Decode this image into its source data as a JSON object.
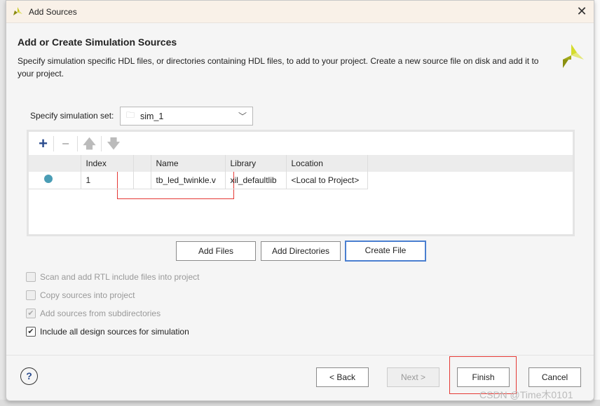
{
  "window": {
    "title": "Add Sources",
    "close_icon": "close-icon"
  },
  "header": {
    "title": "Add or Create Simulation Sources",
    "description": "Specify simulation specific HDL files, or directories containing HDL files, to add to your project. Create a new source file on disk and add it to your project."
  },
  "simset": {
    "label": "Specify simulation set:",
    "value": "sim_1"
  },
  "table": {
    "columns": [
      "",
      "Index",
      "",
      "Name",
      "Library",
      "Location"
    ],
    "rows": [
      {
        "status": "dot",
        "index": "1",
        "name": "tb_led_twinkle.v",
        "library": "xil_defaultlib",
        "location": "<Local to Project>"
      }
    ]
  },
  "buttons": {
    "add_files": "Add Files",
    "add_directories": "Add Directories",
    "create_file": "Create File",
    "back": "< Back",
    "next": "Next >",
    "finish": "Finish",
    "cancel": "Cancel"
  },
  "options": [
    {
      "label": "Scan and add RTL include files into project",
      "checked": false,
      "enabled": false
    },
    {
      "label": "Copy sources into project",
      "checked": false,
      "enabled": false
    },
    {
      "label": "Add sources from subdirectories",
      "checked": true,
      "enabled": false
    },
    {
      "label": "Include all design sources for simulation",
      "checked": true,
      "enabled": true
    }
  ],
  "watermark": "CSDN @Time木0101",
  "colors": {
    "status_dot": "#4a9db5",
    "highlight": "#e53935",
    "focus": "#4a7fd0"
  }
}
